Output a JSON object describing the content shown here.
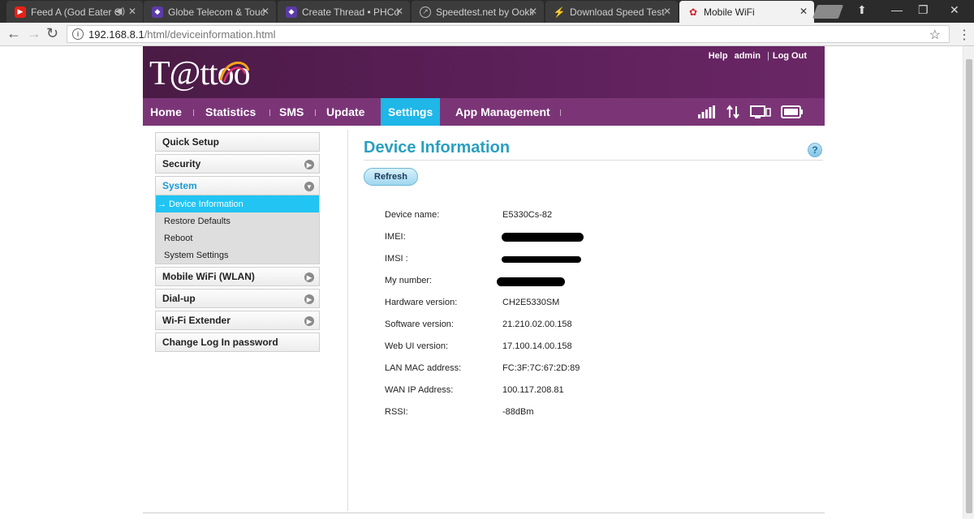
{
  "browser": {
    "tabs": [
      {
        "title": "Feed A (God Eater O",
        "favicon_color": "#e62117",
        "active": false
      },
      {
        "title": "Globe Telecom & Touch",
        "favicon_color": "#5b3ba8",
        "active": false
      },
      {
        "title": "Create Thread • PHCorn",
        "favicon_color": "#5b3ba8",
        "active": false
      },
      {
        "title": "Speedtest.net by Ookla",
        "favicon_color": "#666666",
        "active": false
      },
      {
        "title": "Download Speed Test R",
        "favicon_color": "#555555",
        "active": false
      },
      {
        "title": "Mobile WiFi",
        "favicon_color": "#d81e2a",
        "active": true
      }
    ],
    "url_host": "192.168.8.1",
    "url_path": "/html/deviceinformation.html"
  },
  "header": {
    "logo_text": "T@ttoo",
    "links": {
      "help": "Help",
      "user": "admin",
      "logout": "Log Out"
    }
  },
  "nav": {
    "items": [
      "Home",
      "Statistics",
      "SMS",
      "Update",
      "Settings",
      "App Management"
    ],
    "active": "Settings"
  },
  "sidebar": {
    "items": [
      {
        "label": "Quick Setup",
        "has_arrow": false
      },
      {
        "label": "Security",
        "has_arrow": true
      },
      {
        "label": "System",
        "has_arrow": true,
        "open": true,
        "subitems": [
          "Device Information",
          "Restore Defaults",
          "Reboot",
          "System Settings"
        ],
        "active_subitem": "Device Information"
      },
      {
        "label": "Mobile WiFi (WLAN)",
        "has_arrow": true
      },
      {
        "label": "Dial-up",
        "has_arrow": true
      },
      {
        "label": "Wi-Fi Extender",
        "has_arrow": true
      },
      {
        "label": "Change Log In password",
        "has_arrow": false
      }
    ]
  },
  "content": {
    "title": "Device Information",
    "help_label": "?",
    "refresh_label": "Refresh",
    "rows": [
      {
        "label": "Device name:",
        "value": "E5330Cs-82"
      },
      {
        "label": "IMEI:",
        "value": "",
        "redacted": true
      },
      {
        "label": "IMSI :",
        "value": "",
        "redacted": true
      },
      {
        "label": "My number:",
        "value": "",
        "redacted": true
      },
      {
        "label": "Hardware version:",
        "value": "CH2E5330SM"
      },
      {
        "label": "Software version:",
        "value": "21.210.02.00.158"
      },
      {
        "label": "Web UI version:",
        "value": "17.100.14.00.158"
      },
      {
        "label": "LAN MAC address:",
        "value": "FC:3F:7C:67:2D:89"
      },
      {
        "label": "WAN IP Address:",
        "value": "100.117.208.81"
      },
      {
        "label": "RSSI:",
        "value": "-88dBm"
      }
    ]
  }
}
